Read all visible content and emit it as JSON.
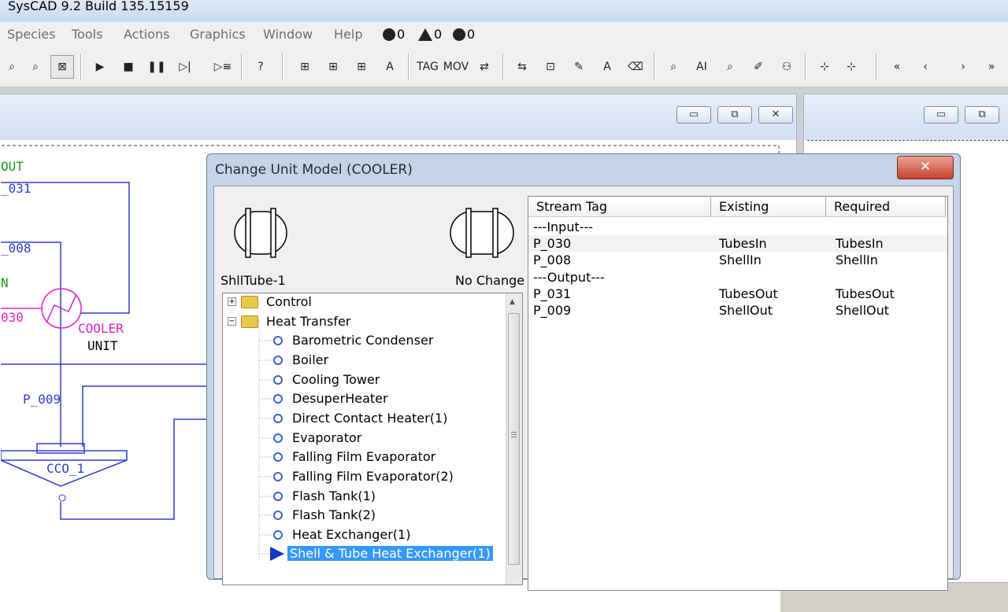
{
  "window": {
    "title": "SysCAD 9.2 Build 135.15159"
  },
  "menu": {
    "items": [
      "Species",
      "Tools",
      "Actions",
      "Graphics",
      "Window",
      "Help"
    ],
    "status_counts": [
      "0",
      "0",
      "0"
    ]
  },
  "flowsheet": {
    "labels": {
      "out": "OUT",
      "p031": "_031",
      "p008": "_008",
      "n": "N",
      "p030": "030",
      "cooler": "COOLER",
      "unit": "UNIT",
      "p009": "P_009",
      "cco1": "CCO_1"
    }
  },
  "dialog": {
    "title": "Change Unit Model (COOLER)",
    "close_label": "✕",
    "left_caption": "ShllTube-1",
    "right_caption": "No Change",
    "tree": {
      "folders": [
        "Control",
        "Heat Transfer"
      ],
      "items": [
        "Barometric Condenser",
        "Boiler",
        "Cooling Tower",
        "DesuperHeater",
        "Direct Contact Heater(1)",
        "Evaporator",
        "Falling Film Evaporator",
        "Falling Film Evaporator(2)",
        "Flash Tank(1)",
        "Flash Tank(2)",
        "Heat Exchanger(1)",
        "Shell & Tube Heat Exchanger(1)"
      ]
    },
    "table": {
      "headers": [
        "Stream Tag",
        "Existing",
        "Required"
      ],
      "rows": [
        [
          "---Input---",
          "",
          ""
        ],
        [
          "P_030",
          "TubesIn",
          "TubesIn"
        ],
        [
          "P_008",
          "ShellIn",
          "ShellIn"
        ],
        [
          "---Output---",
          "",
          ""
        ],
        [
          "P_031",
          "TubesOut",
          "TubesOut"
        ],
        [
          "P_009",
          "ShellOut",
          "ShellOut"
        ]
      ]
    }
  }
}
